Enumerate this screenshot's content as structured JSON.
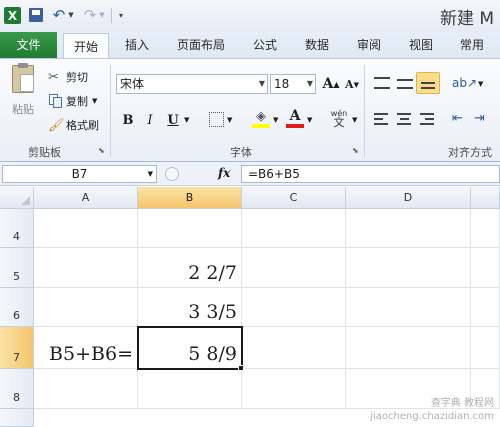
{
  "window": {
    "title": "新建 M"
  },
  "tabs": {
    "file": "文件",
    "home": "开始",
    "insert": "插入",
    "page_layout": "页面布局",
    "formulas": "公式",
    "data": "数据",
    "review": "审阅",
    "view": "视图",
    "general": "常用"
  },
  "ribbon": {
    "clipboard": {
      "paste": "粘贴",
      "cut": "剪切",
      "copy": "复制",
      "format_painter": "格式刷",
      "group_label": "剪贴板"
    },
    "font": {
      "font_name": "宋体",
      "font_size": "18",
      "bold": "B",
      "italic": "I",
      "underline": "U",
      "phonetic": "wén",
      "group_label": "字体"
    },
    "alignment": {
      "group_label": "对齐方式"
    }
  },
  "formula_bar": {
    "name_box": "B7",
    "fx": "fx",
    "formula": "=B6+B5"
  },
  "sheet": {
    "columns": [
      "A",
      "B",
      "C",
      "D"
    ],
    "selected_column": "B",
    "rows": [
      {
        "num": "4",
        "a": "",
        "b": ""
      },
      {
        "num": "5",
        "a": "",
        "b": "2 2/7"
      },
      {
        "num": "6",
        "a": "",
        "b": "3 3/5"
      },
      {
        "num": "7",
        "a": "B5+B6=",
        "b": "5 8/9"
      },
      {
        "num": "8",
        "a": "",
        "b": ""
      }
    ],
    "selected_row": "7",
    "active_cell": "B7"
  },
  "watermark": {
    "line1": "查字典 教程网",
    "line2": "jiaocheng.chazidian.com"
  },
  "colors": {
    "file_tab": "#1f7a33",
    "selected_header": "#f5c56a",
    "active_border": "#1a1a1a"
  }
}
